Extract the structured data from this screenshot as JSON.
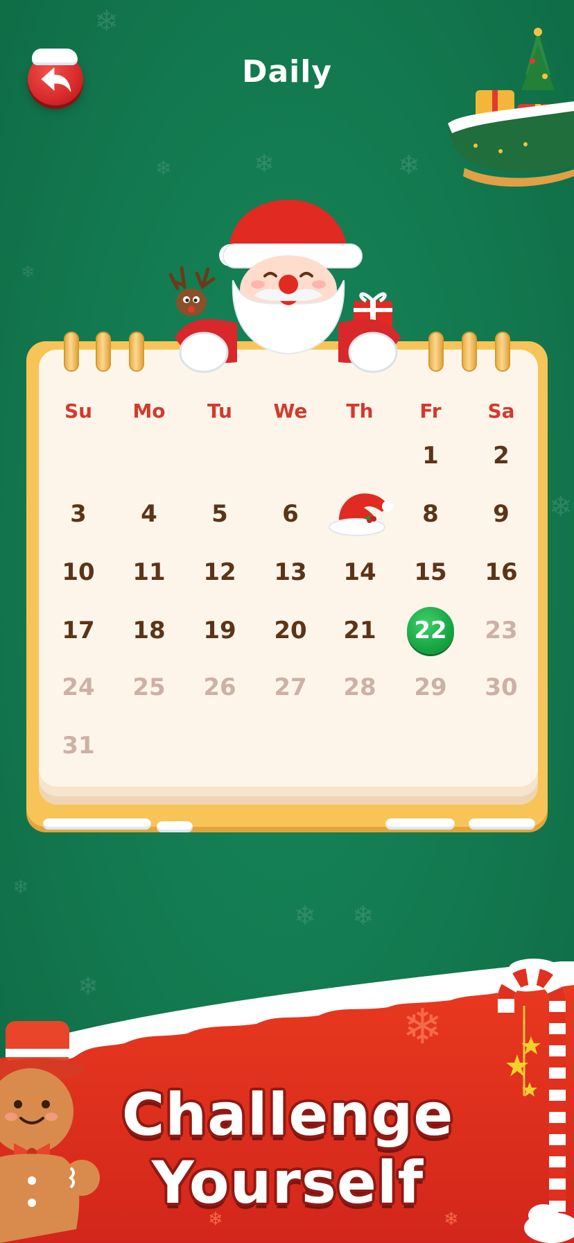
{
  "header": {
    "title": "Daily",
    "back_icon": "back-arrow-icon"
  },
  "calendar": {
    "weekdays": [
      "Su",
      "Mo",
      "Tu",
      "We",
      "Th",
      "Fr",
      "Sa"
    ],
    "first_weekday_index": 5,
    "days_in_month": 31,
    "completed_day": 7,
    "completed_icon": "santa-hat-icon",
    "today": 22,
    "colors": {
      "weekday": "#d33a2c",
      "past_day": "#5c3417",
      "future_day": "#cdb0a6",
      "today_bg": "#18a645",
      "frame": "#f8c457",
      "paper": "#fdf5ea"
    }
  },
  "banner": {
    "line1": "Challenge",
    "line2": "Yourself"
  },
  "colors": {
    "background": "#137a50",
    "banner_red": "#e2301f",
    "back_button": "#d72a2a"
  }
}
